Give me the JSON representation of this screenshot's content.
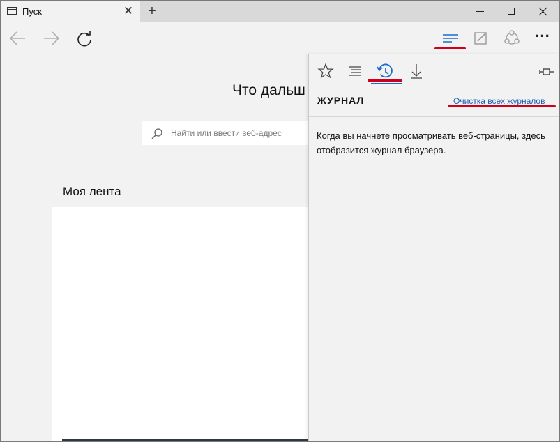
{
  "tab": {
    "title": "Пуск",
    "close": "✕",
    "new": "+"
  },
  "window_controls": {
    "minimize": "minimize",
    "maximize": "maximize",
    "close": "✕"
  },
  "nav": {
    "back": "back",
    "forward": "forward",
    "refresh": "refresh",
    "hub": "hub",
    "note": "web-note",
    "share": "share",
    "more": "···"
  },
  "main": {
    "headline": "Что дальш",
    "search_placeholder": "Найти или ввести веб-адрес",
    "feed_label": "Моя лента"
  },
  "hub": {
    "tabs": [
      "favorites",
      "reading-list",
      "history",
      "downloads"
    ],
    "active_tab": "history",
    "title": "ЖУРНАЛ",
    "clear_link": "Очистка всех журналов",
    "empty_message": "Когда вы начнете просматривать веб-страницы, здесь отобразится журнал браузера."
  },
  "colors": {
    "accent": "#1a6ec8",
    "annotation_red": "#d0001a",
    "link": "#1a5fb4"
  }
}
